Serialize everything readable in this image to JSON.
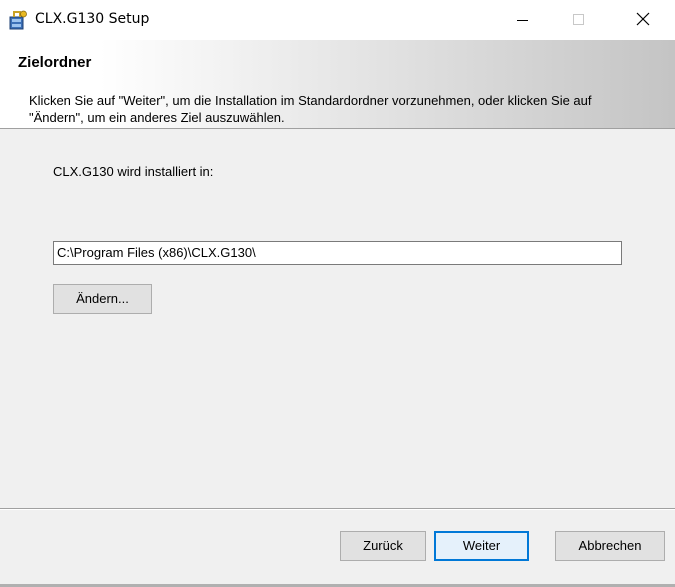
{
  "window": {
    "title": "CLX.G130 Setup",
    "icon": "installer-package-icon",
    "controls": {
      "minimize_icon": "minimize-icon",
      "maximize_icon": "maximize-icon",
      "close_icon": "close-icon"
    }
  },
  "header": {
    "title": "Zielordner",
    "description": "Klicken Sie auf \"Weiter\", um die Installation im Standardordner vorzunehmen, oder klicken Sie auf \"Ändern\", um ein anderes Ziel auszuwählen."
  },
  "body": {
    "install_label": "CLX.G130 wird installiert in:",
    "install_path": "C:\\Program Files (x86)\\CLX.G130\\",
    "change_button": "Ändern..."
  },
  "footer": {
    "back_button": "Zurück",
    "next_button": "Weiter",
    "cancel_button": "Abbrechen"
  },
  "colors": {
    "window_bg": "#f0f0f0",
    "focus_border": "#0078d7"
  }
}
